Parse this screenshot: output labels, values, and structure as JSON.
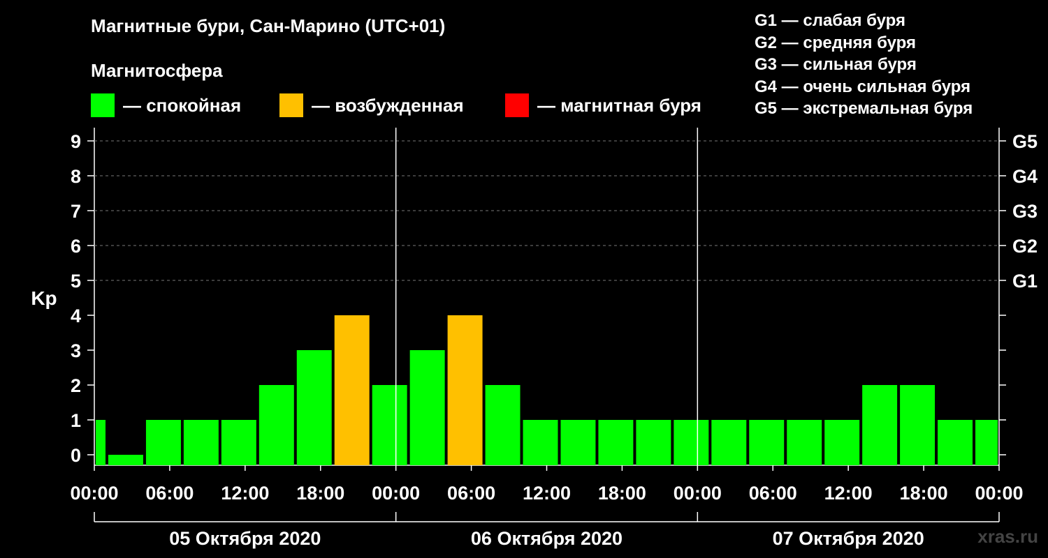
{
  "page": {
    "title": "Магнитные бури, Сан-Марино (UTC+01)",
    "subtitle": "Магнитосфера",
    "watermark": "xras.ru",
    "legend": [
      {
        "label": "— спокойная",
        "color": "#00FF00"
      },
      {
        "label": "— возбужденная",
        "color": "#FFC000"
      },
      {
        "label": "— магнитная буря",
        "color": "#FF0000"
      }
    ],
    "g_legend": [
      "G1 — слабая буря",
      "G2 — средняя буря",
      "G3 — сильная буря",
      "G4 — очень сильная буря",
      "G5 — экстремальная буря"
    ]
  },
  "chart_data": {
    "type": "bar",
    "ylabel": "Kp",
    "ylim": [
      0,
      9
    ],
    "y_ticks": [
      0,
      1,
      2,
      3,
      4,
      5,
      6,
      7,
      8,
      9
    ],
    "right_ticks": [
      {
        "kp": 5,
        "label": "G1"
      },
      {
        "kp": 6,
        "label": "G2"
      },
      {
        "kp": 7,
        "label": "G3"
      },
      {
        "kp": 8,
        "label": "G4"
      },
      {
        "kp": 9,
        "label": "G5"
      }
    ],
    "grid": "horizontal dashed at Kp 5–9",
    "time_range_hours": [
      0,
      72
    ],
    "x_tick_labels": [
      "00:00",
      "06:00",
      "12:00",
      "18:00",
      "00:00",
      "06:00",
      "12:00",
      "18:00",
      "00:00",
      "06:00",
      "12:00",
      "18:00",
      "00:00"
    ],
    "day_labels": [
      "05 Октября 2020",
      "06 Октября 2020",
      "07 Октября 2020"
    ],
    "bars": [
      {
        "start": "05.10 00:00",
        "end": "05.10 01:00",
        "kp": 1,
        "level": "quiet"
      },
      {
        "start": "05.10 01:00",
        "end": "05.10 04:00",
        "kp": 0,
        "level": "quiet"
      },
      {
        "start": "05.10 04:00",
        "end": "05.10 07:00",
        "kp": 1,
        "level": "quiet"
      },
      {
        "start": "05.10 07:00",
        "end": "05.10 10:00",
        "kp": 1,
        "level": "quiet"
      },
      {
        "start": "05.10 10:00",
        "end": "05.10 13:00",
        "kp": 1,
        "level": "quiet"
      },
      {
        "start": "05.10 13:00",
        "end": "05.10 16:00",
        "kp": 2,
        "level": "quiet"
      },
      {
        "start": "05.10 16:00",
        "end": "05.10 19:00",
        "kp": 3,
        "level": "quiet"
      },
      {
        "start": "05.10 19:00",
        "end": "05.10 22:00",
        "kp": 4,
        "level": "unsettled"
      },
      {
        "start": "05.10 22:00",
        "end": "06.10 01:00",
        "kp": 2,
        "level": "quiet"
      },
      {
        "start": "06.10 01:00",
        "end": "06.10 04:00",
        "kp": 3,
        "level": "quiet"
      },
      {
        "start": "06.10 04:00",
        "end": "06.10 07:00",
        "kp": 4,
        "level": "unsettled"
      },
      {
        "start": "06.10 07:00",
        "end": "06.10 10:00",
        "kp": 2,
        "level": "quiet"
      },
      {
        "start": "06.10 10:00",
        "end": "06.10 13:00",
        "kp": 1,
        "level": "quiet"
      },
      {
        "start": "06.10 13:00",
        "end": "06.10 16:00",
        "kp": 1,
        "level": "quiet"
      },
      {
        "start": "06.10 16:00",
        "end": "06.10 19:00",
        "kp": 1,
        "level": "quiet"
      },
      {
        "start": "06.10 19:00",
        "end": "06.10 22:00",
        "kp": 1,
        "level": "quiet"
      },
      {
        "start": "06.10 22:00",
        "end": "07.10 01:00",
        "kp": 1,
        "level": "quiet"
      },
      {
        "start": "07.10 01:00",
        "end": "07.10 04:00",
        "kp": 1,
        "level": "quiet"
      },
      {
        "start": "07.10 04:00",
        "end": "07.10 07:00",
        "kp": 1,
        "level": "quiet"
      },
      {
        "start": "07.10 07:00",
        "end": "07.10 10:00",
        "kp": 1,
        "level": "quiet"
      },
      {
        "start": "07.10 10:00",
        "end": "07.10 13:00",
        "kp": 1,
        "level": "quiet"
      },
      {
        "start": "07.10 13:00",
        "end": "07.10 16:00",
        "kp": 2,
        "level": "quiet"
      },
      {
        "start": "07.10 16:00",
        "end": "07.10 19:00",
        "kp": 2,
        "level": "quiet"
      },
      {
        "start": "07.10 19:00",
        "end": "07.10 22:00",
        "kp": 1,
        "level": "quiet"
      },
      {
        "start": "07.10 22:00",
        "end": "08.10 00:00",
        "kp": 1,
        "level": "quiet"
      }
    ],
    "level_colors": {
      "quiet": "#00FF00",
      "unsettled": "#FFC000",
      "storm": "#FF0000"
    }
  }
}
